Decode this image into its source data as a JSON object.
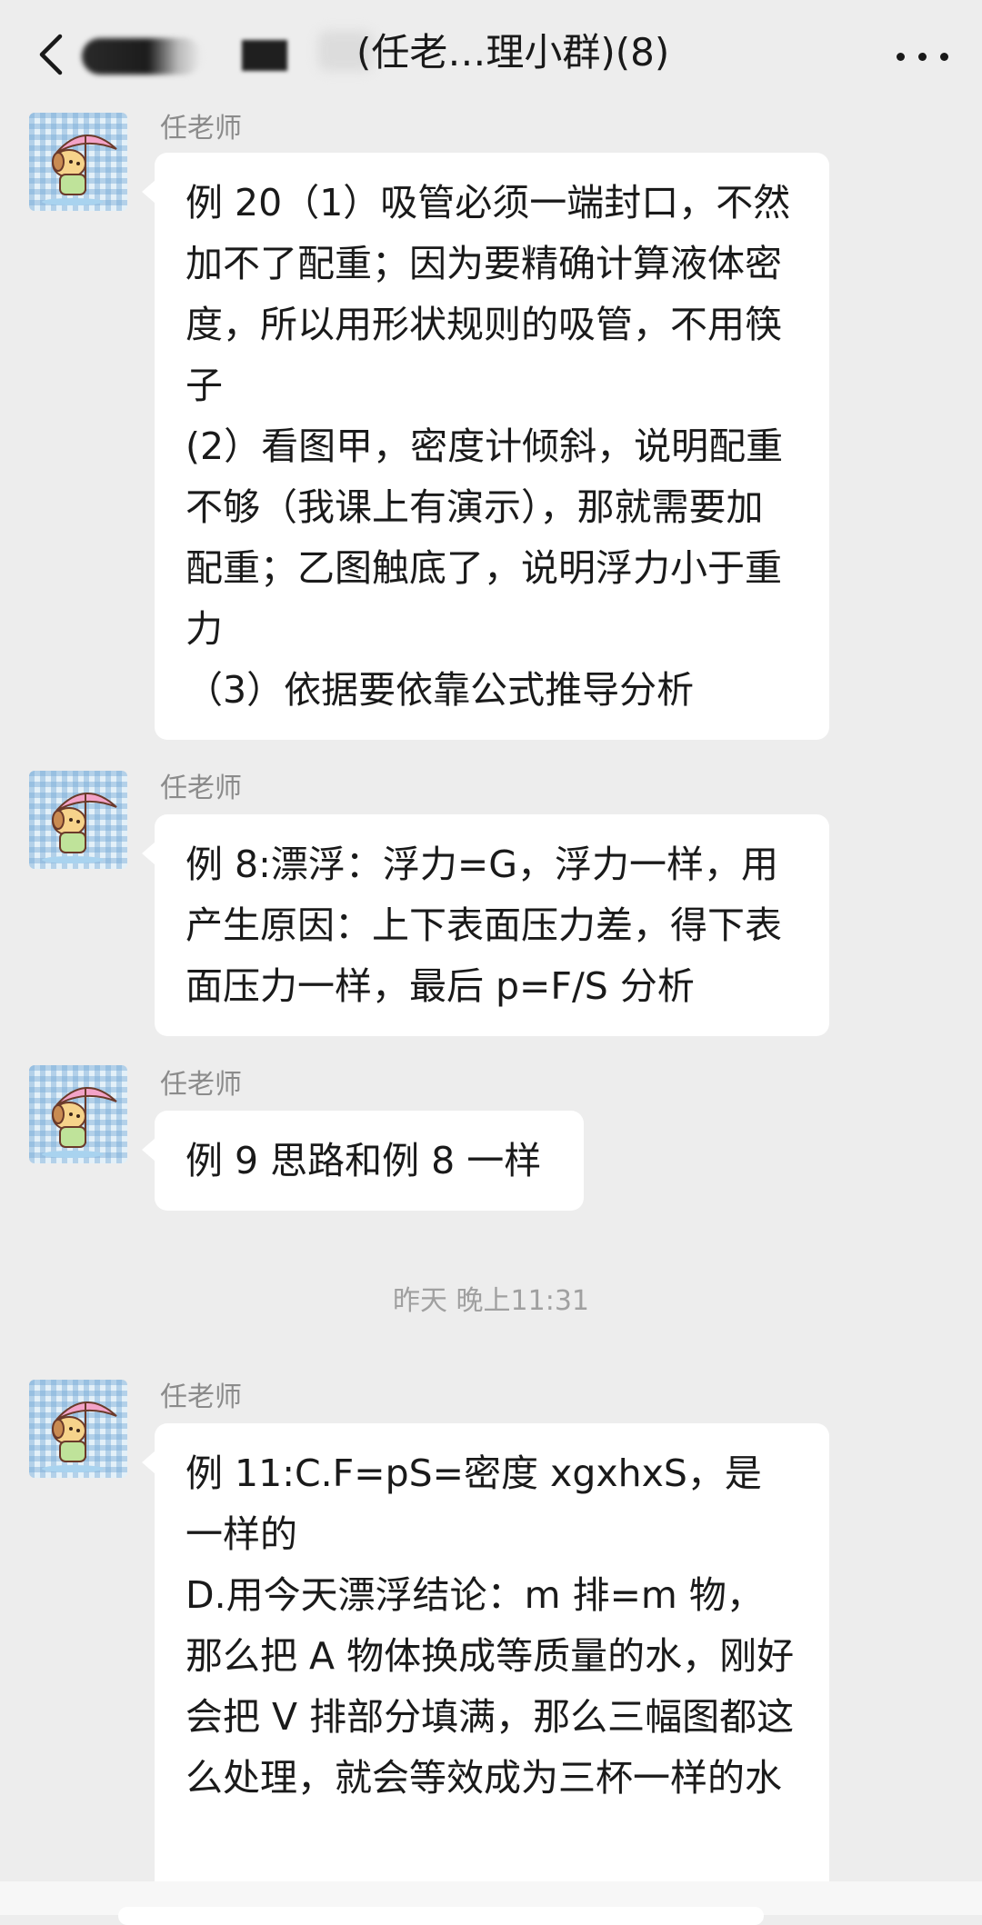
{
  "header": {
    "title_visible": "(任老…理小群)(8)"
  },
  "messages": [
    {
      "sender": "任老师",
      "text": "例 20（1）吸管必须一端封口，不然加不了配重；因为要精确计算液体密度，所以用形状规则的吸管，不用筷子\n(2）看图甲，密度计倾斜，说明配重不够（我课上有演示），那就需要加配重；乙图触底了，说明浮力小于重力\n（3）依据要依靠公式推导分析"
    },
    {
      "sender": "任老师",
      "text": "例 8:漂浮：浮力=G，浮力一样，用产生原因：上下表面压力差，得下表面压力一样，最后 p=F/S 分析"
    },
    {
      "sender": "任老师",
      "text": "例 9 思路和例 8 一样"
    },
    {
      "sender": "任老师",
      "text": "例 11:C.F=pS=密度 xgxhxS，是一样的\nD.用今天漂浮结论：m 排=m 物，那么把 A 物体换成等质量的水，刚好会把 V 排部分填满，那么三幅图都这么处理，就会等效成为三杯一样的水"
    }
  ],
  "timestamp": "昨天 晚上11:31",
  "colors": {
    "background": "#ededed",
    "bubble": "#ffffff",
    "sender": "#8b8b8b",
    "timestamp": "#a0a0a0"
  },
  "icons": [
    "back-icon",
    "more-icon",
    "avatar-image"
  ]
}
